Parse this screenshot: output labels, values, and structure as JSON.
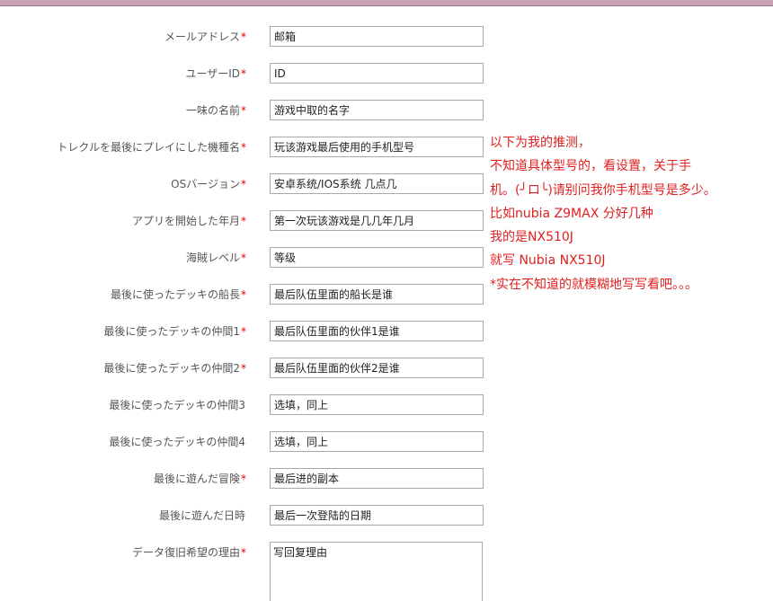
{
  "form": {
    "fields": [
      {
        "label": "メールアドレス",
        "required": "*",
        "value": "邮箱"
      },
      {
        "label": "ユーザーID",
        "required": "*",
        "value": "ID"
      },
      {
        "label": "一味の名前",
        "required": "*",
        "value": "游戏中取的名字"
      },
      {
        "label": "トレクルを最後にプレイにした機種名",
        "required": "*",
        "value": "玩该游戏最后使用的手机型号"
      },
      {
        "label": "OSバージョン",
        "required": "*",
        "value": "安卓系统/IOS系统 几点几"
      },
      {
        "label": "アプリを開始した年月",
        "required": "*",
        "value": "第一次玩该游戏是几几年几月"
      },
      {
        "label": "海賊レベル",
        "required": "*",
        "value": "等级"
      },
      {
        "label": "最後に使ったデッキの船長",
        "required": "*",
        "value": "最后队伍里面的船长是谁"
      },
      {
        "label": "最後に使ったデッキの仲間1",
        "required": "*",
        "value": "最后队伍里面的伙伴1是谁"
      },
      {
        "label": "最後に使ったデッキの仲間2",
        "required": "*",
        "value": "最后队伍里面的伙伴2是谁"
      },
      {
        "label": "最後に使ったデッキの仲間3",
        "required": "",
        "value": "选填，同上"
      },
      {
        "label": "最後に使ったデッキの仲間4",
        "required": "",
        "value": "选填，同上"
      },
      {
        "label": "最後に遊んだ冒険",
        "required": "*",
        "value": "最后进的副本"
      },
      {
        "label": "最後に遊んだ日時",
        "required": "",
        "value": "最后一次登陆的日期"
      }
    ],
    "reason": {
      "label": "データ復旧希望の理由",
      "required": "*",
      "value": "写回复理由"
    }
  },
  "note": {
    "lines": [
      "以下为我的推测，",
      "不知道具体型号的，看设置，关于手",
      "机。(╯ロ╰)请别问我你手机型号是多少。",
      "比如nubia Z9MAX 分好几种",
      "我的是NX510J",
      "就写 Nubia NX510J",
      "*实在不知道的就模糊地写写看吧。。。"
    ]
  },
  "colors": {
    "required": "#e00000",
    "note": "#e02020",
    "top_bar": "#c9a3b4"
  }
}
